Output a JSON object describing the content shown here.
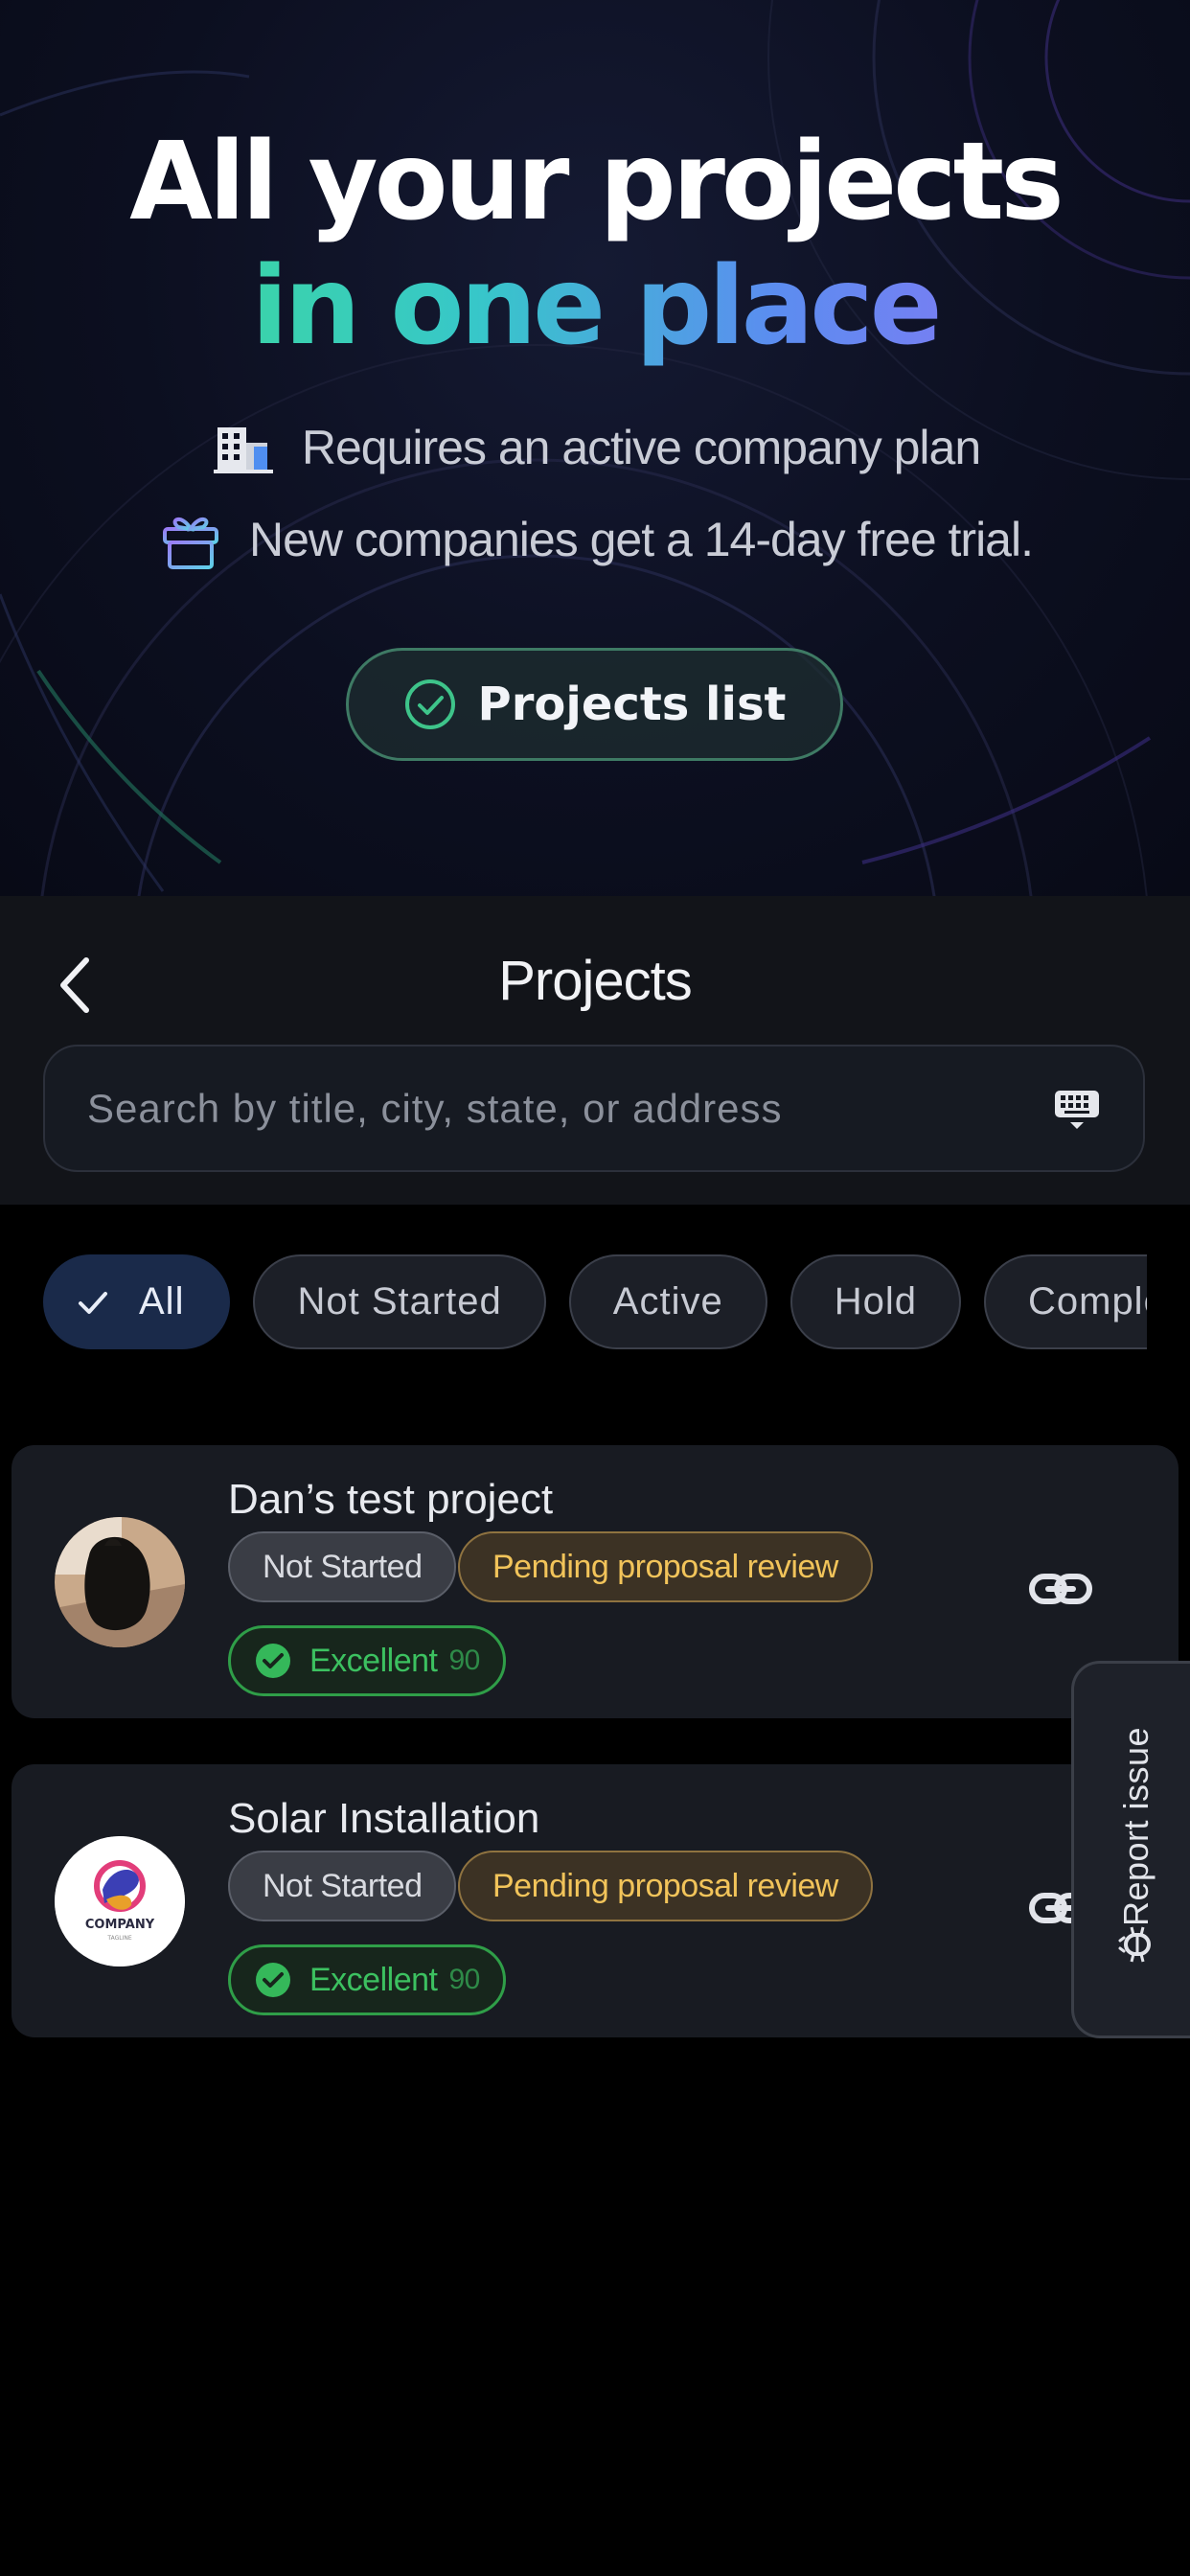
{
  "hero": {
    "title_line1": "All your projects",
    "title_line2": "in one place",
    "info1": "Requires an active company plan",
    "info2": "New companies get a 14-day free trial.",
    "button_label": "Projects list",
    "icons": [
      "building-icon",
      "gift-icon",
      "check-circle-icon"
    ]
  },
  "header": {
    "title": "Projects",
    "back_icon": "chevron-left-icon"
  },
  "search": {
    "placeholder": "Search by title, city, state, or address",
    "value": "",
    "icon": "keyboard-icon"
  },
  "filters": [
    {
      "label": "All",
      "selected": true
    },
    {
      "label": "Not Started",
      "selected": false
    },
    {
      "label": "Active",
      "selected": false
    },
    {
      "label": "Hold",
      "selected": false
    },
    {
      "label": "Completed",
      "selected": false
    }
  ],
  "projects": [
    {
      "title": "Dan’s test project",
      "status": "Not Started",
      "review": "Pending proposal review",
      "score_label": "Excellent",
      "score_value": "90",
      "avatar": "dog-photo"
    },
    {
      "title": "Solar Installation",
      "status": "Not Started",
      "review": "Pending proposal review",
      "score_label": "Excellent",
      "score_value": "90",
      "avatar": "company-logo",
      "logo_text": "COMPANY",
      "logo_tagline": "TAGLINE"
    }
  ],
  "report": {
    "label": "Report issue",
    "icon": "bug-icon"
  },
  "colors": {
    "background": "#000000",
    "card": "#181b22",
    "accent_green": "#3cc160",
    "pending_amber": "#f2c45a",
    "chip_selected": "#1a2a4a"
  }
}
